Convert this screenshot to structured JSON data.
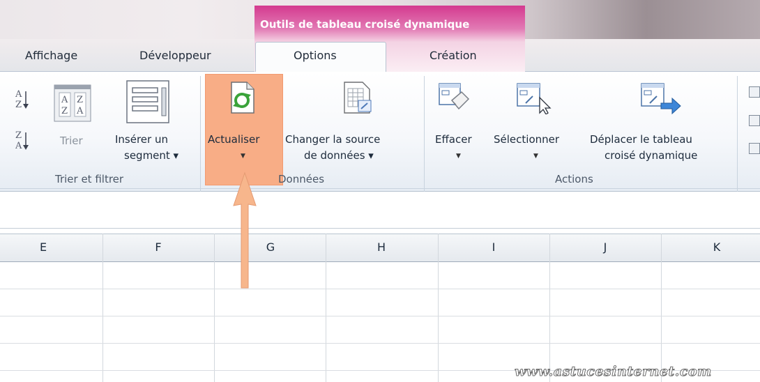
{
  "tabs": {
    "context_group": "Outils de tableau croisé dynamique",
    "affichage": "Affichage",
    "developpeur": "Développeur",
    "options": "Options",
    "creation": "Création"
  },
  "groups": {
    "trier": {
      "label": "Trier et filtrer",
      "trier_btn": "Trier",
      "inserer_line1": "Insérer un",
      "inserer_line2": "segment ▾"
    },
    "donnees": {
      "label": "Données",
      "actualiser": "Actualiser",
      "changer_line1": "Changer la source",
      "changer_line2": "de données ▾"
    },
    "actions": {
      "label": "Actions",
      "effacer": "Effacer",
      "selectionner": "Sélectionner",
      "deplacer_line1": "Déplacer le tableau",
      "deplacer_line2": "croisé dynamique"
    }
  },
  "columns": [
    "E",
    "F",
    "G",
    "H",
    "I",
    "J",
    "K"
  ],
  "watermark": "www.astucesinternet.com",
  "colors": {
    "context_tab": "#d43a8f",
    "highlight": "#f8ad86",
    "arrow": "#f7b68c"
  }
}
